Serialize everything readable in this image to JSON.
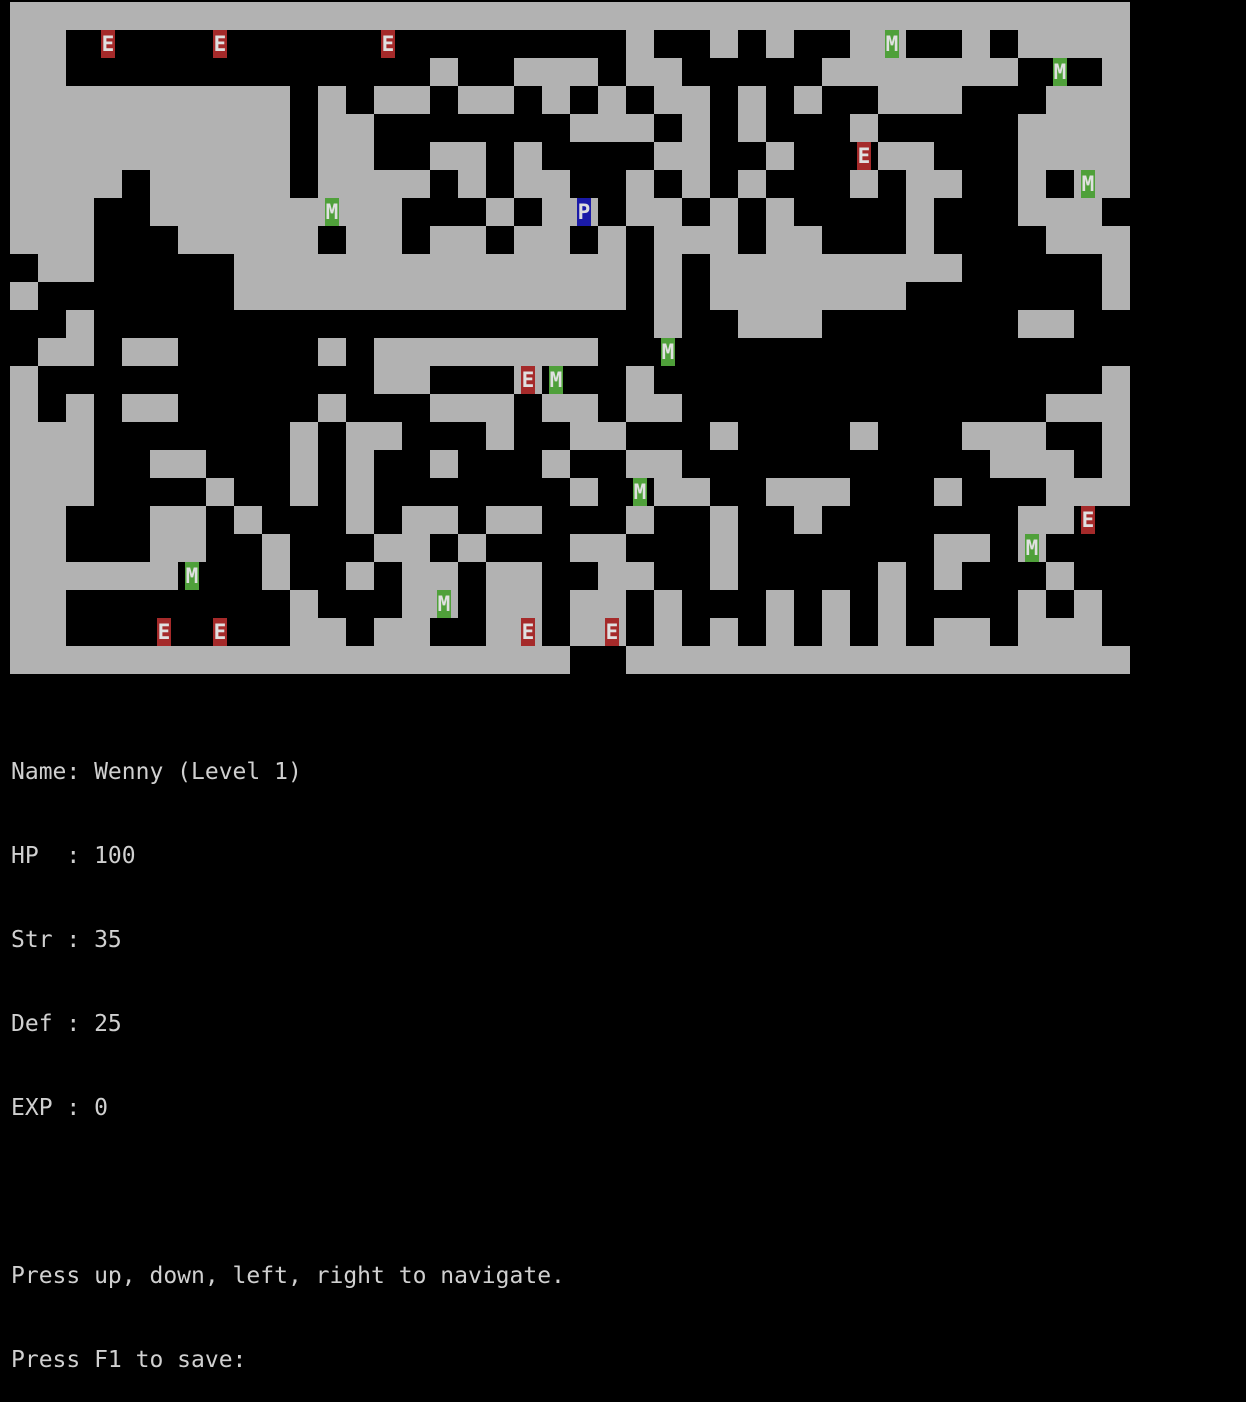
{
  "game": {
    "colors": {
      "background": "#000000",
      "wall": "#b2b2b2",
      "text": "#d0d0d0",
      "player_bg": "#1a1aa8",
      "player_fg": "#dcdcdc",
      "enemy_bg": "#a52a2a",
      "enemy_fg": "#e0e0e0",
      "monster_bg": "#4fa03a",
      "monster_fg": "#e0e0e0"
    },
    "maze_rows": [
      "########################################",
      "##                    #  # #  ##  # ####",
      "##             #  ### ##     #######   #",
      "########## # ## ## # # ## # #  ###   ###",
      "########## ##       ### # #   #     ####",
      "########## ##  ## #    ##  #   ##   ####",
      "#### ##### #### # ##  # # #   # ##  # ##",
      "###  #########   # ## ## # #    #   ###",
      "###   ##### ## ## ## # ### ##   #    ###",
      " ##     ############## # #########     #",
      "#       ############## # #######       #",
      "  #                    #  ###       ##  ",
      " ## ##     # ########                   ",
      "#            ##   #   #                #",
      "# # ##     #   ### ## ##             ###",
      "###       # ##   #  ##   #    #   ###  #",
      "###  ##   # #  #   #  ##           ### #",
      "###    #  # #       #  ##  ###   #   ###",
      "##   ## #   # ## ##   #  #  #       ## ",
      "##   ##  #   ## #   ##   #       ## #  ",
      "######   #  # ## ##  ##  #     # #   # ",
      "##        #   ## ## ## #   # # #    # #",
      "##        ## ##  ## ## # # # # # ## ###",
      "####################  ##################"
    ],
    "entities": [
      {
        "glyph": "E",
        "kind": "enemy",
        "row": 1,
        "col": 3
      },
      {
        "glyph": "E",
        "kind": "enemy",
        "row": 1,
        "col": 7
      },
      {
        "glyph": "E",
        "kind": "enemy",
        "row": 1,
        "col": 13
      },
      {
        "glyph": "M",
        "kind": "monster",
        "row": 1,
        "col": 31
      },
      {
        "glyph": "M",
        "kind": "monster",
        "row": 2,
        "col": 37
      },
      {
        "glyph": "E",
        "kind": "enemy",
        "row": 5,
        "col": 30
      },
      {
        "glyph": "M",
        "kind": "monster",
        "row": 6,
        "col": 38
      },
      {
        "glyph": "M",
        "kind": "monster",
        "row": 7,
        "col": 11
      },
      {
        "glyph": "P",
        "kind": "player",
        "row": 7,
        "col": 20
      },
      {
        "glyph": "M",
        "kind": "monster",
        "row": 12,
        "col": 23
      },
      {
        "glyph": "E",
        "kind": "enemy",
        "row": 13,
        "col": 18
      },
      {
        "glyph": "M",
        "kind": "monster",
        "row": 13,
        "col": 19
      },
      {
        "glyph": "M",
        "kind": "monster",
        "row": 17,
        "col": 22
      },
      {
        "glyph": "E",
        "kind": "enemy",
        "row": 18,
        "col": 38
      },
      {
        "glyph": "M",
        "kind": "monster",
        "row": 19,
        "col": 36
      },
      {
        "glyph": "M",
        "kind": "monster",
        "row": 20,
        "col": 6
      },
      {
        "glyph": "M",
        "kind": "monster",
        "row": 21,
        "col": 15
      },
      {
        "glyph": "E",
        "kind": "enemy",
        "row": 22,
        "col": 5
      },
      {
        "glyph": "E",
        "kind": "enemy",
        "row": 22,
        "col": 7
      },
      {
        "glyph": "E",
        "kind": "enemy",
        "row": 22,
        "col": 18
      },
      {
        "glyph": "E",
        "kind": "enemy",
        "row": 22,
        "col": 21
      }
    ]
  },
  "status": {
    "name_line": "Name: Wenny (Level 1)",
    "hp_line": "HP  : 100",
    "str_line": "Str : 35",
    "def_line": "Def : 25",
    "exp_line": "EXP : 0",
    "help_navigate": "Press up, down, left, right to navigate.",
    "help_save": "Press F1 to save:"
  }
}
